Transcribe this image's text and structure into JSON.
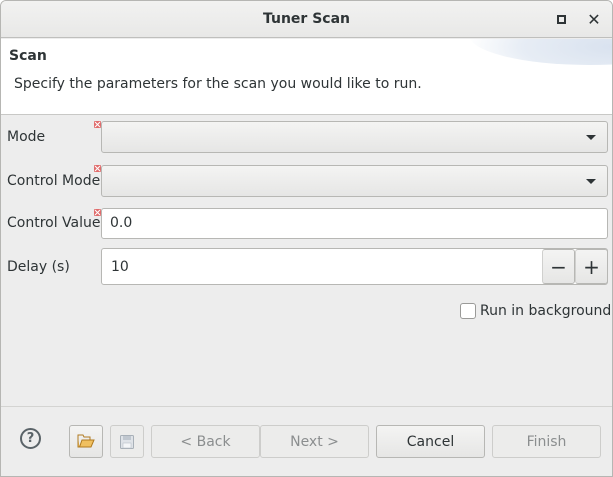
{
  "window": {
    "title": "Tuner Scan"
  },
  "banner": {
    "title": "Scan",
    "description": "Specify the parameters for the scan you would like to run."
  },
  "form": {
    "mode": {
      "label": "Mode",
      "value": ""
    },
    "control_mode": {
      "label": "Control Mode",
      "value": ""
    },
    "control_value": {
      "label": "Control Value",
      "value": "0.0"
    },
    "delay": {
      "label": "Delay (s)",
      "value": "10",
      "decrement": "−",
      "increment": "+"
    },
    "run_in_background": {
      "label": "Run in background",
      "checked": false
    }
  },
  "footer": {
    "help": "?",
    "back_label": "< Back",
    "next_label": "Next >",
    "cancel_label": "Cancel",
    "finish_label": "Finish"
  },
  "colors": {
    "error_marker": "#e06c6c",
    "dialog_bg": "#ededed",
    "disabled_text": "#8b8e8f"
  },
  "icons": [
    "maximize-icon",
    "close-icon",
    "error-icon",
    "chevron-down-icon",
    "help-icon",
    "open-folder-icon",
    "save-icon"
  ]
}
